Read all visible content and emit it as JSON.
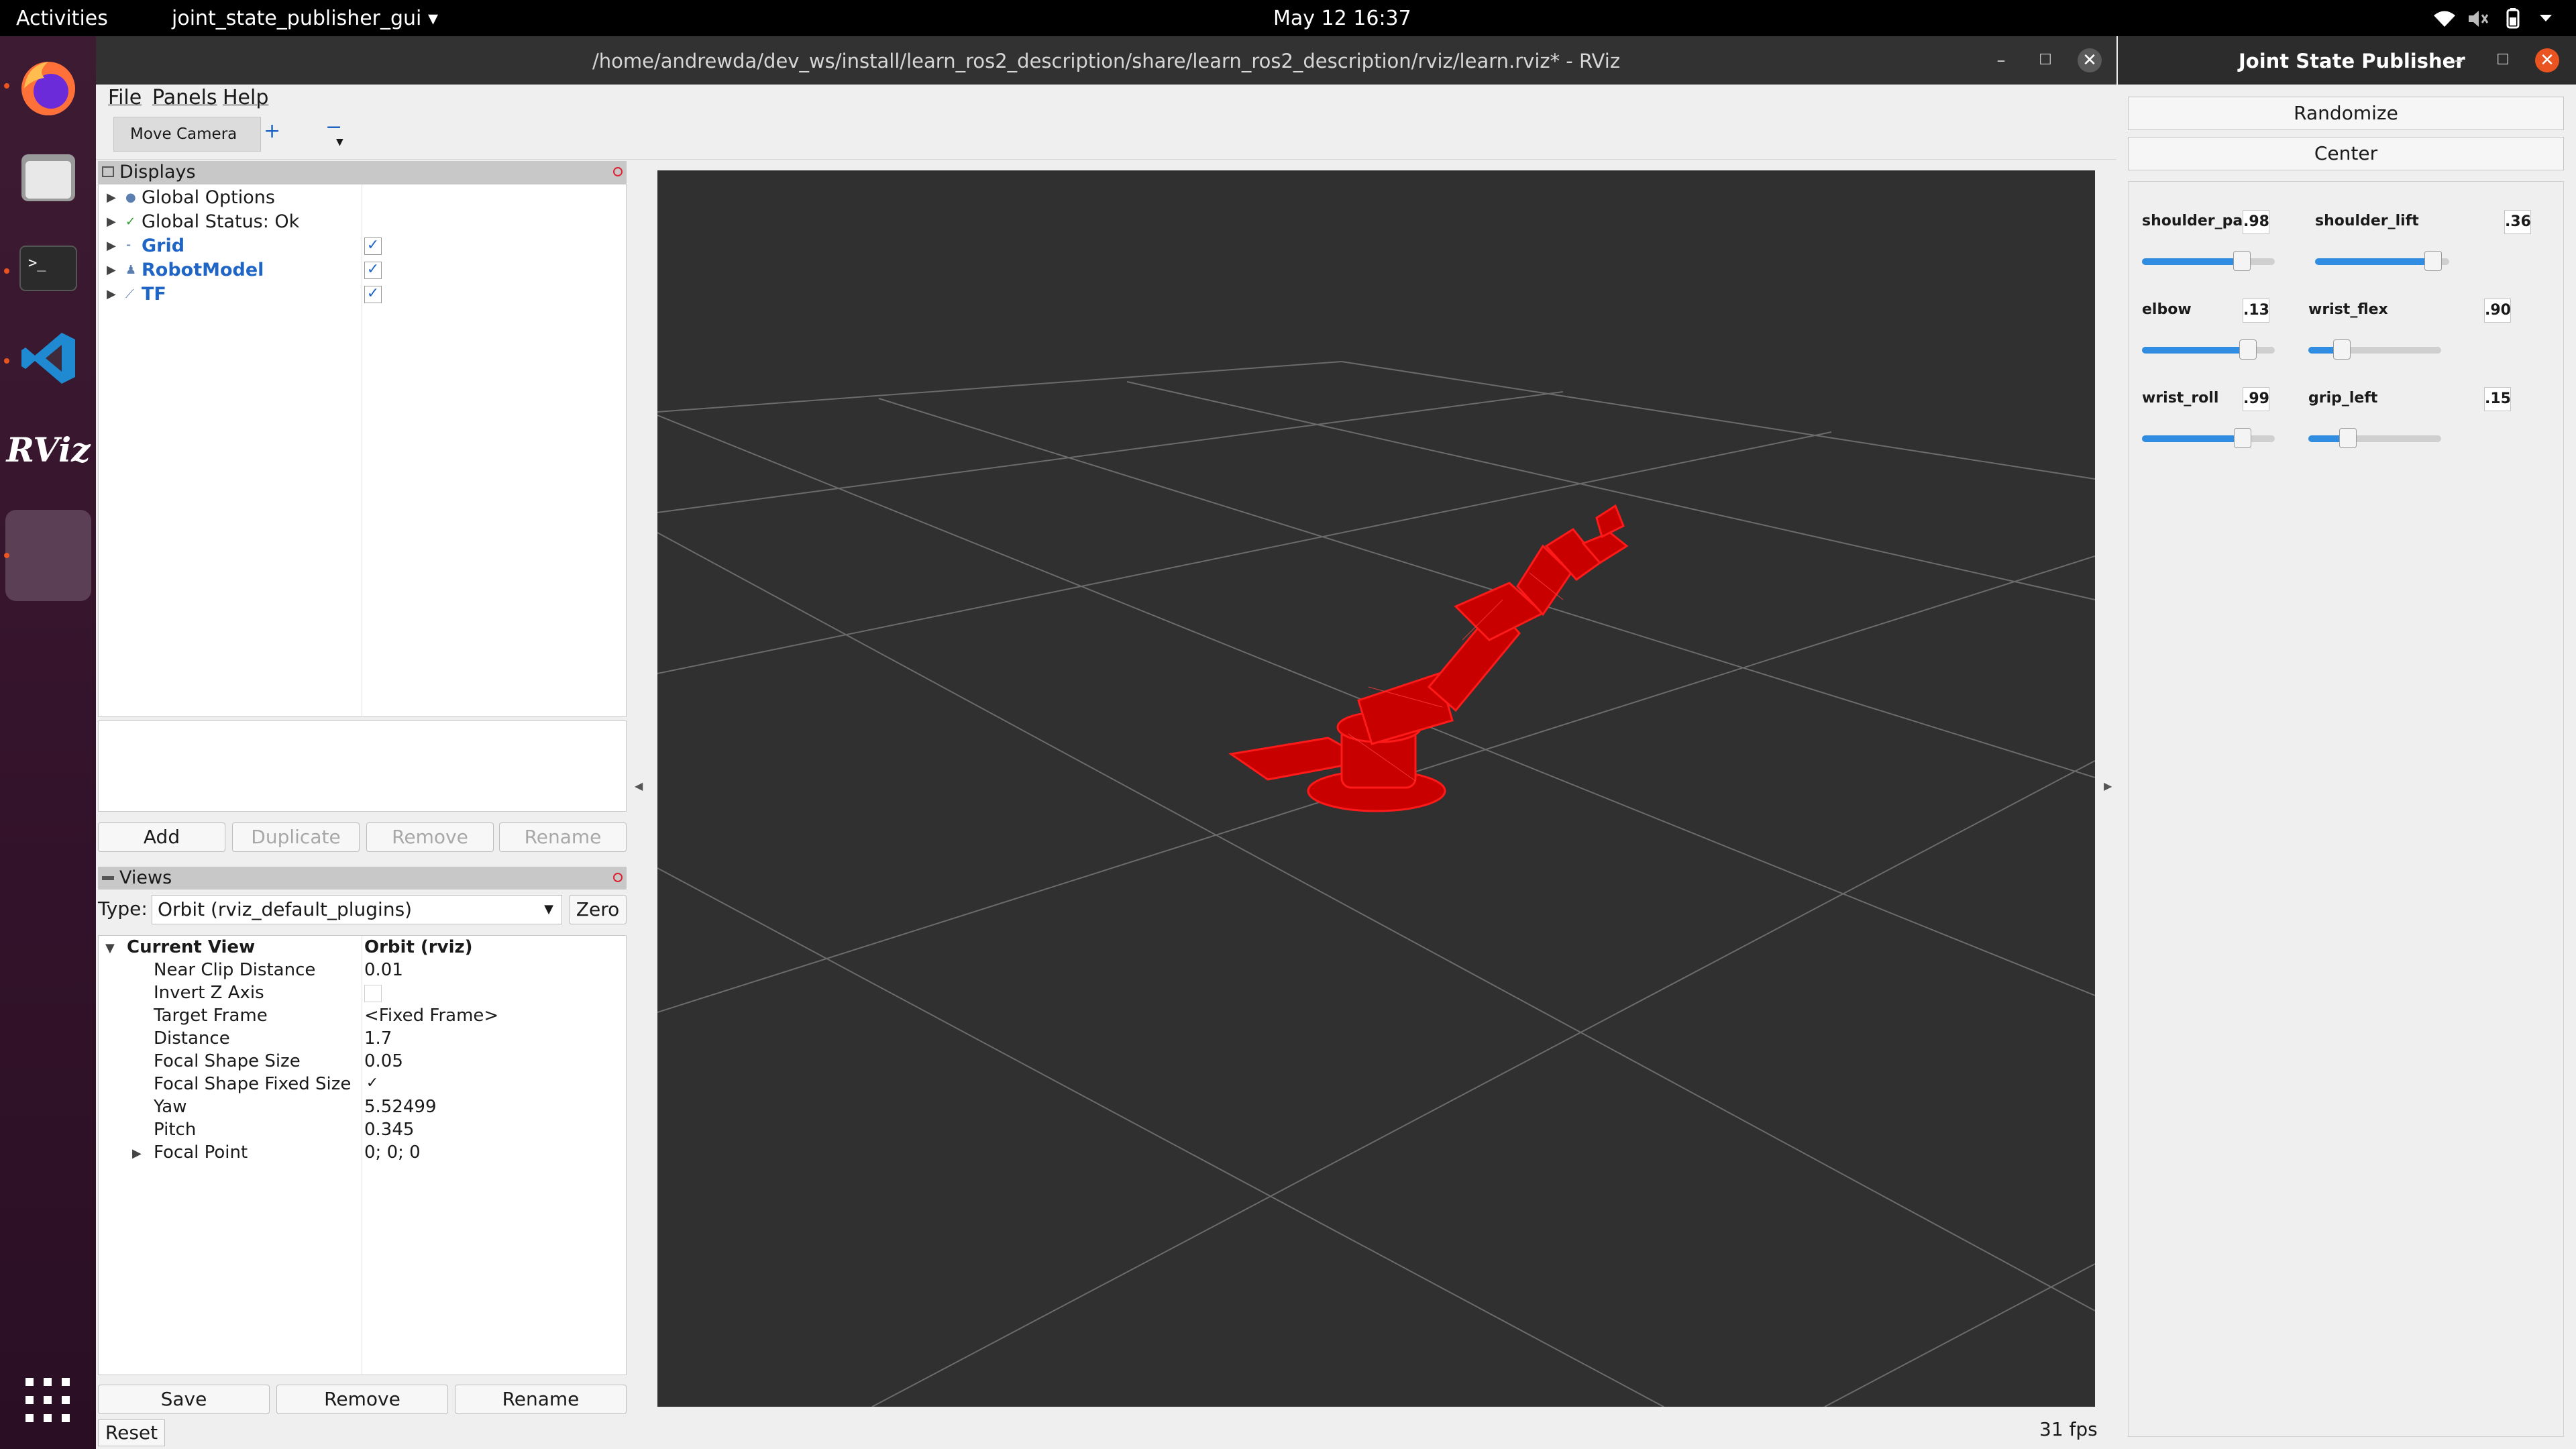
{
  "topbar": {
    "activities": "Activities",
    "app_name": "joint_state_publisher_gui",
    "app_menu_caret": "▾",
    "clock": "May 12  16:37",
    "status_icons": [
      "wifi-icon",
      "volume-icon",
      "battery-icon",
      "chevron-down-icon"
    ]
  },
  "dock": {
    "apps": [
      "firefox-icon",
      "files-icon",
      "terminal-icon",
      "vscode-icon",
      "rviz-icon",
      "running-app-icon"
    ],
    "rviz_label": "RViz",
    "apps_grid": "show-applications-icon"
  },
  "rviz": {
    "title": "/home/andrewda/dev_ws/install/learn_ros2_description/share/learn_ros2_description/rviz/learn.rviz* - RViz",
    "menu": [
      "File",
      "Panels",
      "Help"
    ],
    "toolbar": {
      "move_camera": "Move Camera",
      "plus": "+",
      "minus": "−"
    },
    "displays": {
      "header": "Displays",
      "items": [
        {
          "label": "Global Options",
          "icon": "●",
          "checkbox": false,
          "checked": false
        },
        {
          "label": "Global Status: Ok",
          "icon": "✓",
          "checkbox": false,
          "checked": false
        },
        {
          "label": "Grid",
          "icon": "⁃",
          "checkbox": true,
          "checked": true
        },
        {
          "label": "RobotModel",
          "icon": "♟",
          "checkbox": true,
          "checked": true
        },
        {
          "label": "TF",
          "icon": "⟋",
          "checkbox": true,
          "checked": true
        }
      ],
      "buttons": [
        "Add",
        "Duplicate",
        "Remove",
        "Rename"
      ]
    },
    "views": {
      "header": "Views",
      "type_label": "Type:",
      "type_value": "Orbit (rviz_default_plugins)",
      "zero": "Zero",
      "current_view": "Current View",
      "current_view_value": "Orbit (rviz)",
      "properties": [
        {
          "name": "Near Clip Distance",
          "value": "0.01"
        },
        {
          "name": "Invert Z Axis",
          "value": "",
          "checkbox": true,
          "checked": false
        },
        {
          "name": "Target Frame",
          "value": "<Fixed Frame>"
        },
        {
          "name": "Distance",
          "value": "1.7"
        },
        {
          "name": "Focal Shape Size",
          "value": "0.05"
        },
        {
          "name": "Focal Shape Fixed Size",
          "value": "✓",
          "checkbox": true,
          "checked": true
        },
        {
          "name": "Yaw",
          "value": "5.52499"
        },
        {
          "name": "Pitch",
          "value": "0.345"
        },
        {
          "name": "Focal Point",
          "value": "0; 0; 0"
        }
      ],
      "buttons": [
        "Save",
        "Remove",
        "Rename"
      ]
    },
    "reset": "Reset",
    "fps": "31 fps",
    "colors": {
      "viewport_bg": "#303030",
      "robot": "#d40000",
      "grid": "#6a6a6a"
    }
  },
  "jsp": {
    "title": "Joint State Publisher",
    "randomize": "Randomize",
    "center": "Center",
    "joints": [
      {
        "name": "shoulder_pan",
        "value": ".98",
        "fraction": 0.75
      },
      {
        "name": "shoulder_lift",
        "value": ".36",
        "fraction": 0.88
      },
      {
        "name": "elbow",
        "value": ".13",
        "fraction": 0.8
      },
      {
        "name": "wrist_flex",
        "value": ".90",
        "fraction": 0.25
      },
      {
        "name": "wrist_roll",
        "value": ".99",
        "fraction": 0.76
      },
      {
        "name": "grip_left",
        "value": ".15",
        "fraction": 0.3
      }
    ],
    "colors": {
      "slider_fill": "#2f8ce0"
    }
  }
}
